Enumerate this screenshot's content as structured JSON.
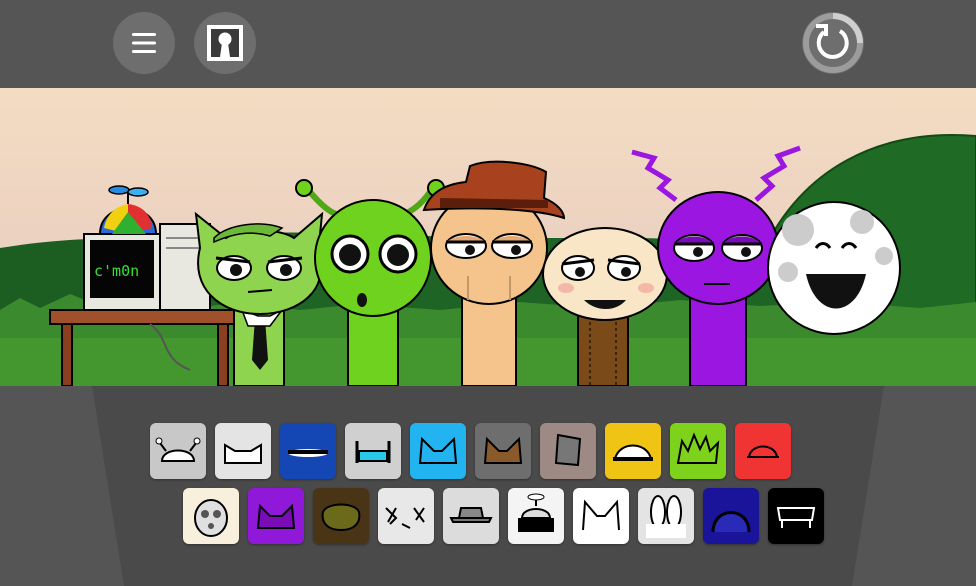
{
  "toolbar": {
    "menu_icon": "hamburger-menu-icon",
    "profile_icon": "keyhole-portrait-icon",
    "reset_icon": "restart-arrow-icon",
    "colors": {
      "bar": "#555555",
      "button": "#6e6e6e"
    }
  },
  "stage": {
    "computer_screen_text": "c'm0n",
    "characters": [
      {
        "id": "propeller-computer",
        "color": "#f2f2f2"
      },
      {
        "id": "green-cat-tie",
        "color": "#8fd44f"
      },
      {
        "id": "lime-antenna",
        "color": "#6fd21e"
      },
      {
        "id": "tan-fedora",
        "color": "#f4c48c"
      },
      {
        "id": "cream-overalls",
        "color": "#f8e6c6"
      },
      {
        "id": "purple-lightning",
        "color": "#9b16e0"
      },
      {
        "id": "white-moon",
        "color": "#ffffff"
      }
    ]
  },
  "palette": {
    "row1": [
      {
        "name": "grey-antenna-tile",
        "bg": "#c8c8c8"
      },
      {
        "name": "white-ears-tile",
        "bg": "#e4e4e4"
      },
      {
        "name": "blue-visor-tile",
        "bg": "#1446b4"
      },
      {
        "name": "grey-headset-tile",
        "bg": "#d0d0d0"
      },
      {
        "name": "cyan-cat-tile",
        "bg": "#22b4f0"
      },
      {
        "name": "brown-cat-tile",
        "bg": "#6e6e6e"
      },
      {
        "name": "bucket-hat-tile",
        "bg": "#9e8a84"
      },
      {
        "name": "yellow-dome-tile",
        "bg": "#f0c414"
      },
      {
        "name": "lime-spiky-tile",
        "bg": "#7ed21c"
      },
      {
        "name": "red-dome-tile",
        "bg": "#f03434"
      }
    ],
    "row2": [
      {
        "name": "cream-egg-tile",
        "bg": "#f8f0dc"
      },
      {
        "name": "purple-horns-tile",
        "bg": "#9018d8"
      },
      {
        "name": "olive-blob-tile",
        "bg": "#4a3416"
      },
      {
        "name": "white-scribble-tile",
        "bg": "#e8e8e8"
      },
      {
        "name": "grey-fedora-tile",
        "bg": "#dcdcdc"
      },
      {
        "name": "propeller-computer-tile",
        "bg": "#f4f4f4"
      },
      {
        "name": "white-cat-tile",
        "bg": "#ffffff"
      },
      {
        "name": "bunny-ears-tile",
        "bg": "#e4e4e4"
      },
      {
        "name": "navy-arch-tile",
        "bg": "#1a149a"
      },
      {
        "name": "black-bench-tile",
        "bg": "#000000"
      }
    ]
  }
}
